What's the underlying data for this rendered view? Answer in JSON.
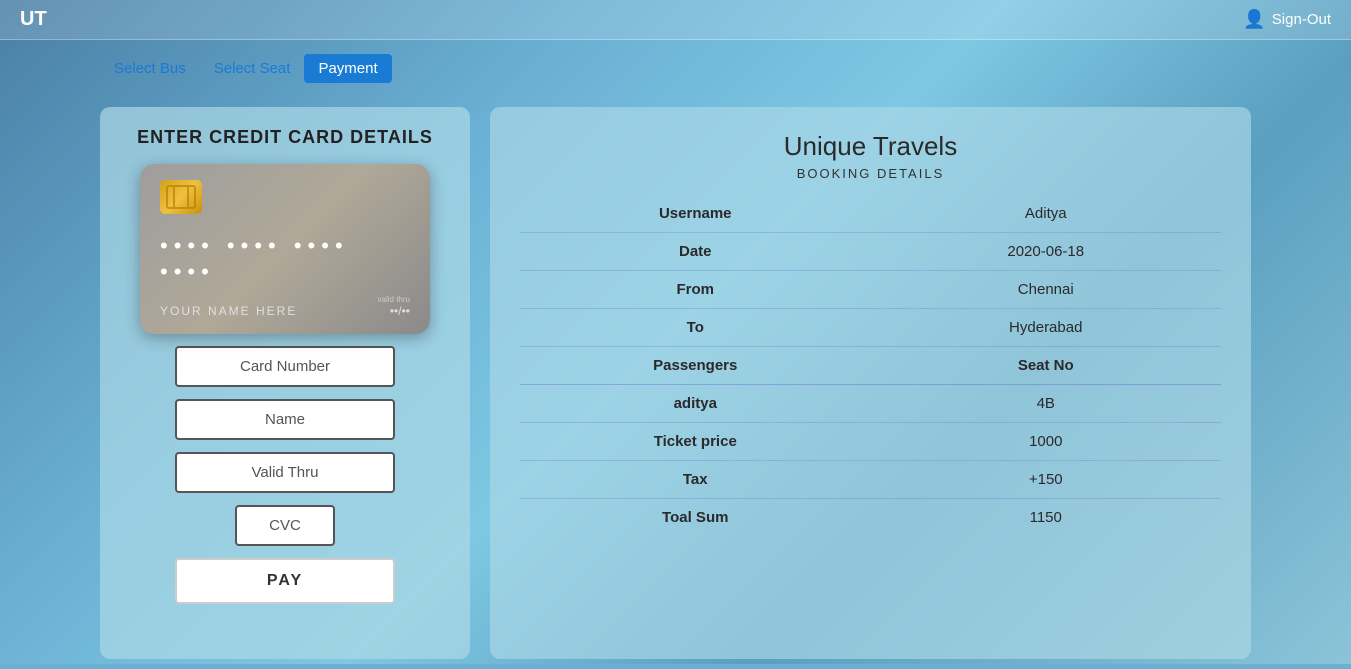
{
  "app": {
    "logo": "UT",
    "signout_label": "Sign-Out"
  },
  "nav": {
    "items": [
      {
        "label": "Select Bus",
        "active": false
      },
      {
        "label": "Select Seat",
        "active": false
      },
      {
        "label": "Payment",
        "active": true
      }
    ]
  },
  "credit_card_section": {
    "title": "ENTER CREDIT CARD DETAILS",
    "card_dots": "•••• •••• •••• ••••",
    "card_name": "YOUR  NAME  HERE",
    "valid_thru_label": "valid thru",
    "valid_thru_value": "••/••",
    "card_number_placeholder": "Card Number",
    "name_placeholder": "Name",
    "valid_thru_placeholder": "Valid Thru",
    "cvc_placeholder": "CVC",
    "pay_button_label": "PAY"
  },
  "booking_details": {
    "title": "Unique Travels",
    "subtitle": "BOOKING DETAILS",
    "rows": [
      {
        "label": "Username",
        "value": "Aditya"
      },
      {
        "label": "Date",
        "value": "2020-06-18"
      },
      {
        "label": "From",
        "value": "Chennai"
      },
      {
        "label": "To",
        "value": "Hyderabad"
      }
    ],
    "passenger_header": "Passengers",
    "seat_header": "Seat No",
    "passenger_name": "aditya",
    "seat_number": "4B",
    "ticket_price_label": "Ticket price",
    "ticket_price_value": "1000",
    "tax_label": "Tax",
    "tax_value": "+150",
    "total_label": "Toal Sum",
    "total_value": "1150"
  }
}
